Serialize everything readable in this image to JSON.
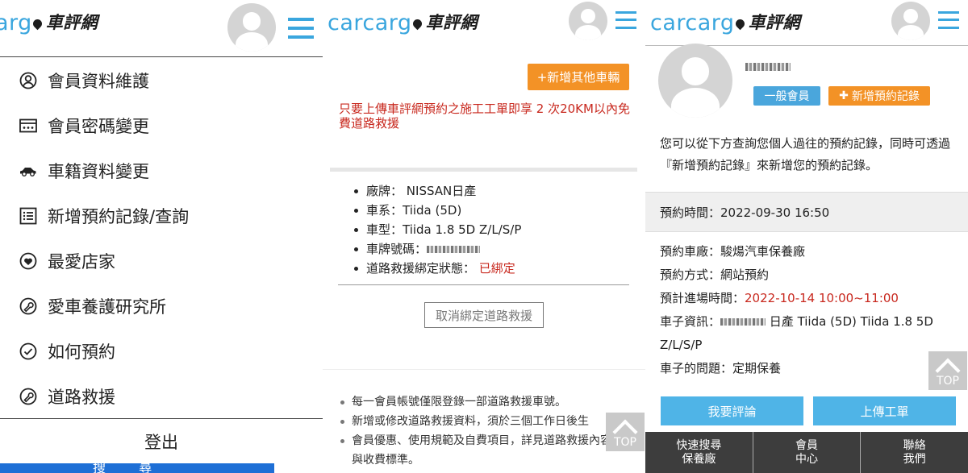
{
  "brand": {
    "latin": "carcarg",
    "latin_cut": "arg",
    "latin_tail": "o",
    "cn": "車評網"
  },
  "colors": {
    "accent_blue": "#3aa6de",
    "orange": "#f39226",
    "red_text": "#c8281e",
    "button_blue": "#4fb4e7",
    "footer_dark": "#3d3d3d"
  },
  "menu": {
    "items": [
      {
        "label": "會員資料維護",
        "icon": "user-circle-icon"
      },
      {
        "label": "會員密碼變更",
        "icon": "password-card-icon"
      },
      {
        "label": "車籍資料變更",
        "icon": "car-icon"
      },
      {
        "label": "新增預約記錄/查詢",
        "icon": "list-icon"
      },
      {
        "label": "最愛店家",
        "icon": "heart-circle-icon"
      },
      {
        "label": "愛車養護研究所",
        "icon": "wrench-circle-icon"
      },
      {
        "label": "如何預約",
        "icon": "check-circle-icon"
      },
      {
        "label": "道路救援",
        "icon": "wrench-circle-icon"
      }
    ],
    "logout": "登出",
    "bottom_strip": "搜 尋"
  },
  "vehicle": {
    "add_button": "+新增其他車輛",
    "promo": "只要上傳車評網預約之施工工單即享 2 次20KM以內免費道路救援",
    "brand_label": "廠牌：",
    "brand_value": "NISSAN日產",
    "series": "車系：Tiida (5D)",
    "model": "車型：Tiida 1.8 5D Z/L/S/P",
    "plate_label": "車牌號碼：",
    "rescue_label": "道路救援綁定狀態：",
    "rescue_value": "已綁定",
    "unbind_button": "取消綁定道路救援",
    "notes": [
      "每一會員帳號僅限登錄一部道路救援車號。",
      "新增或修改道路救援資料，須於三個工作日後生",
      "會員優惠、使用規範及自費項目，詳見道路救援內容與收費標準。"
    ]
  },
  "top_button": "TOP",
  "booking": {
    "member_type": "一般會員",
    "add_booking_button": "新增預約記錄",
    "intro": "您可以從下方查詢您個人過往的預約記錄，同時可透過『新增預約記錄』來新增您的預約記錄。",
    "time": "預約時間：2022-09-30 16:50",
    "shop": "預約車廠：駿煬汽車保養廠",
    "method": "預約方式：網站預約",
    "eta_label": "預計進場時間：",
    "eta_value": "2022-10-14 10:00~11:00",
    "car_label": "車子資訊：",
    "car_value": "日產 Tiida (5D) Tiida 1.8 5D Z/L/S/P",
    "problem": "車子的問題：定期保養",
    "review_button": "我要評論",
    "upload_button": "上傳工單"
  },
  "footer": [
    {
      "line1": "快速搜尋",
      "line2": "保養廠"
    },
    {
      "line1": "會員",
      "line2": "中心"
    },
    {
      "line1": "聯絡",
      "line2": "我們"
    }
  ]
}
